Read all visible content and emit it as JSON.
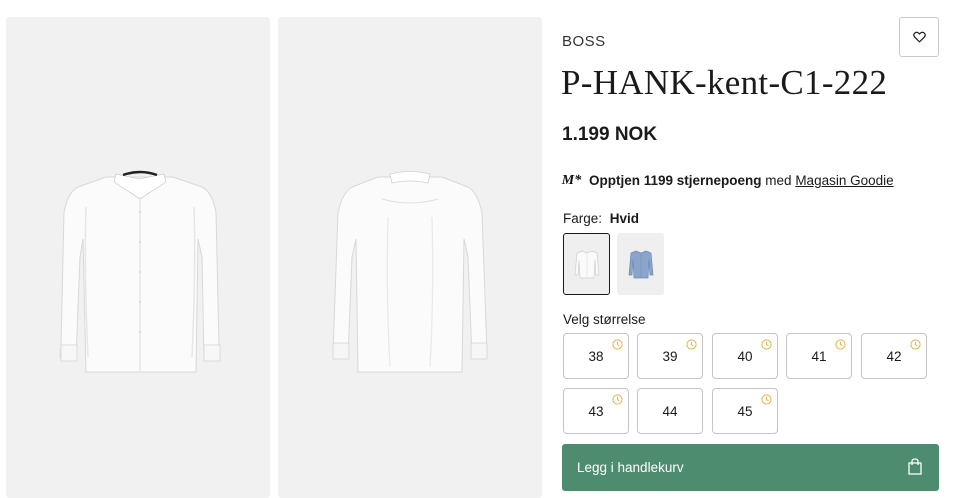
{
  "product": {
    "brand": "BOSS",
    "name": "P-HANK-kent-C1-222",
    "price": "1.199 NOK"
  },
  "loyalty": {
    "logo_text": "M*",
    "earn_text": "Opptjen 1199 stjernepoeng",
    "connector": " med ",
    "program_link": "Magasin Goodie"
  },
  "color": {
    "label": "Farge:",
    "selected": "Hvid",
    "swatches": [
      {
        "name": "Hvid",
        "hex": "#f4f4f4"
      },
      {
        "name": "Blå",
        "hex": "#8aa4cc"
      }
    ]
  },
  "sizes": {
    "label": "Velg størrelse",
    "options": [
      {
        "size": "38",
        "limited": true
      },
      {
        "size": "39",
        "limited": true
      },
      {
        "size": "40",
        "limited": true
      },
      {
        "size": "41",
        "limited": true
      },
      {
        "size": "42",
        "limited": true
      },
      {
        "size": "43",
        "limited": true
      },
      {
        "size": "44",
        "limited": false
      },
      {
        "size": "45",
        "limited": true
      }
    ]
  },
  "cart": {
    "button_label": "Legg i handlekurv"
  },
  "icons": {
    "wishlist": "heart-icon",
    "cart": "shopping-bag-icon",
    "limited_stock": "clock-icon"
  },
  "colors": {
    "accent": "#4e8c6f",
    "limited_icon": "#e0b44a",
    "image_bg": "#f1f1f1"
  }
}
